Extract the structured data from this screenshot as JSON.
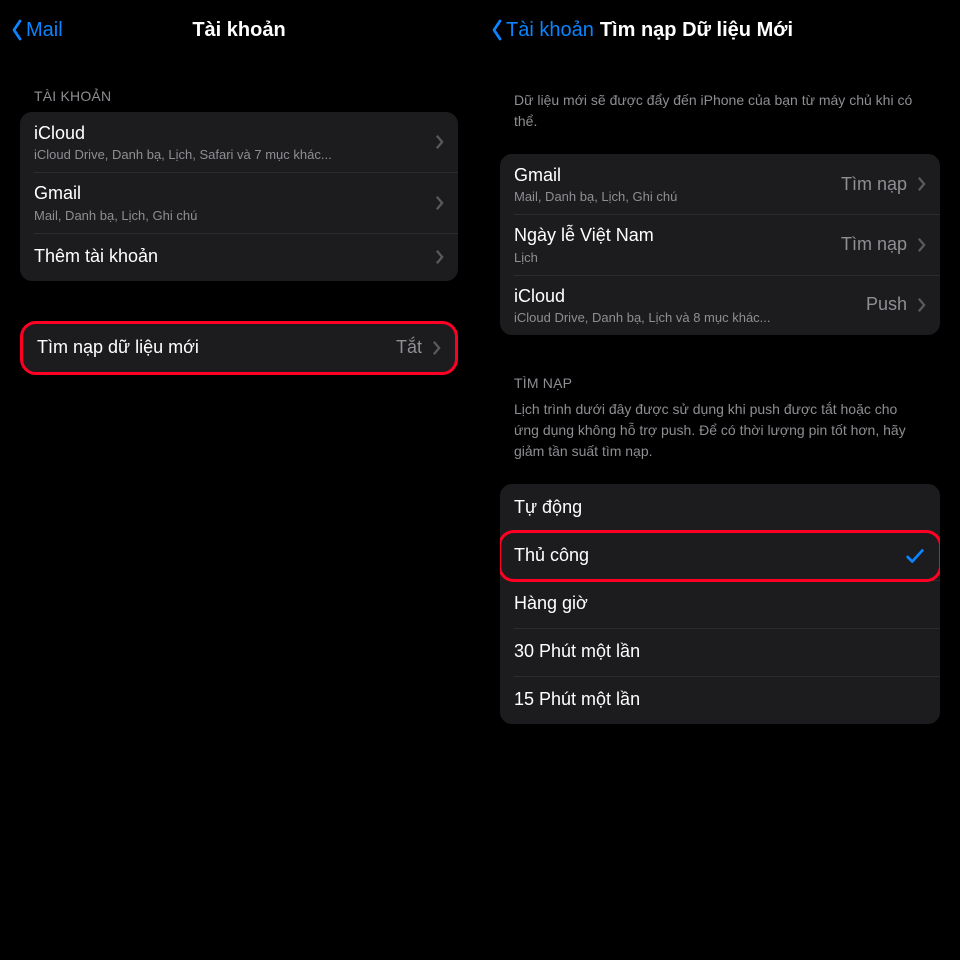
{
  "left": {
    "back_label": "Mail",
    "title": "Tài khoản",
    "accounts_header": "TÀI KHOẢN",
    "accounts": [
      {
        "title": "iCloud",
        "sub": "iCloud Drive, Danh bạ, Lịch, Safari và 7 mục khác..."
      },
      {
        "title": "Gmail",
        "sub": "Mail, Danh bạ, Lịch, Ghi chú"
      },
      {
        "title": "Thêm tài khoản",
        "sub": ""
      }
    ],
    "fetch_label": "Tìm nạp dữ liệu mới",
    "fetch_value": "Tắt"
  },
  "right": {
    "back_label": "Tài khoản",
    "title": "Tìm nạp Dữ liệu Mới",
    "push_footer": "Dữ liệu mới sẽ được đẩy đến iPhone của bạn từ máy chủ khi có thể.",
    "accounts": [
      {
        "title": "Gmail",
        "sub": "Mail, Danh bạ, Lịch, Ghi chú",
        "value": "Tìm nạp"
      },
      {
        "title": "Ngày lễ Việt Nam",
        "sub": "Lịch",
        "value": "Tìm nạp"
      },
      {
        "title": "iCloud",
        "sub": "iCloud Drive, Danh bạ, Lịch và 8 mục khác...",
        "value": "Push"
      }
    ],
    "fetch_header": "TÌM NẠP",
    "fetch_footer": "Lịch trình dưới đây được sử dụng khi push được tắt hoặc cho ứng dụng không hỗ trợ push. Để có thời lượng pin tốt hơn, hãy giảm tần suất tìm nạp.",
    "options": [
      {
        "label": "Tự động",
        "selected": false
      },
      {
        "label": "Thủ công",
        "selected": true
      },
      {
        "label": "Hàng giờ",
        "selected": false
      },
      {
        "label": "30 Phút một lần",
        "selected": false
      },
      {
        "label": "15 Phút một lần",
        "selected": false
      }
    ]
  }
}
